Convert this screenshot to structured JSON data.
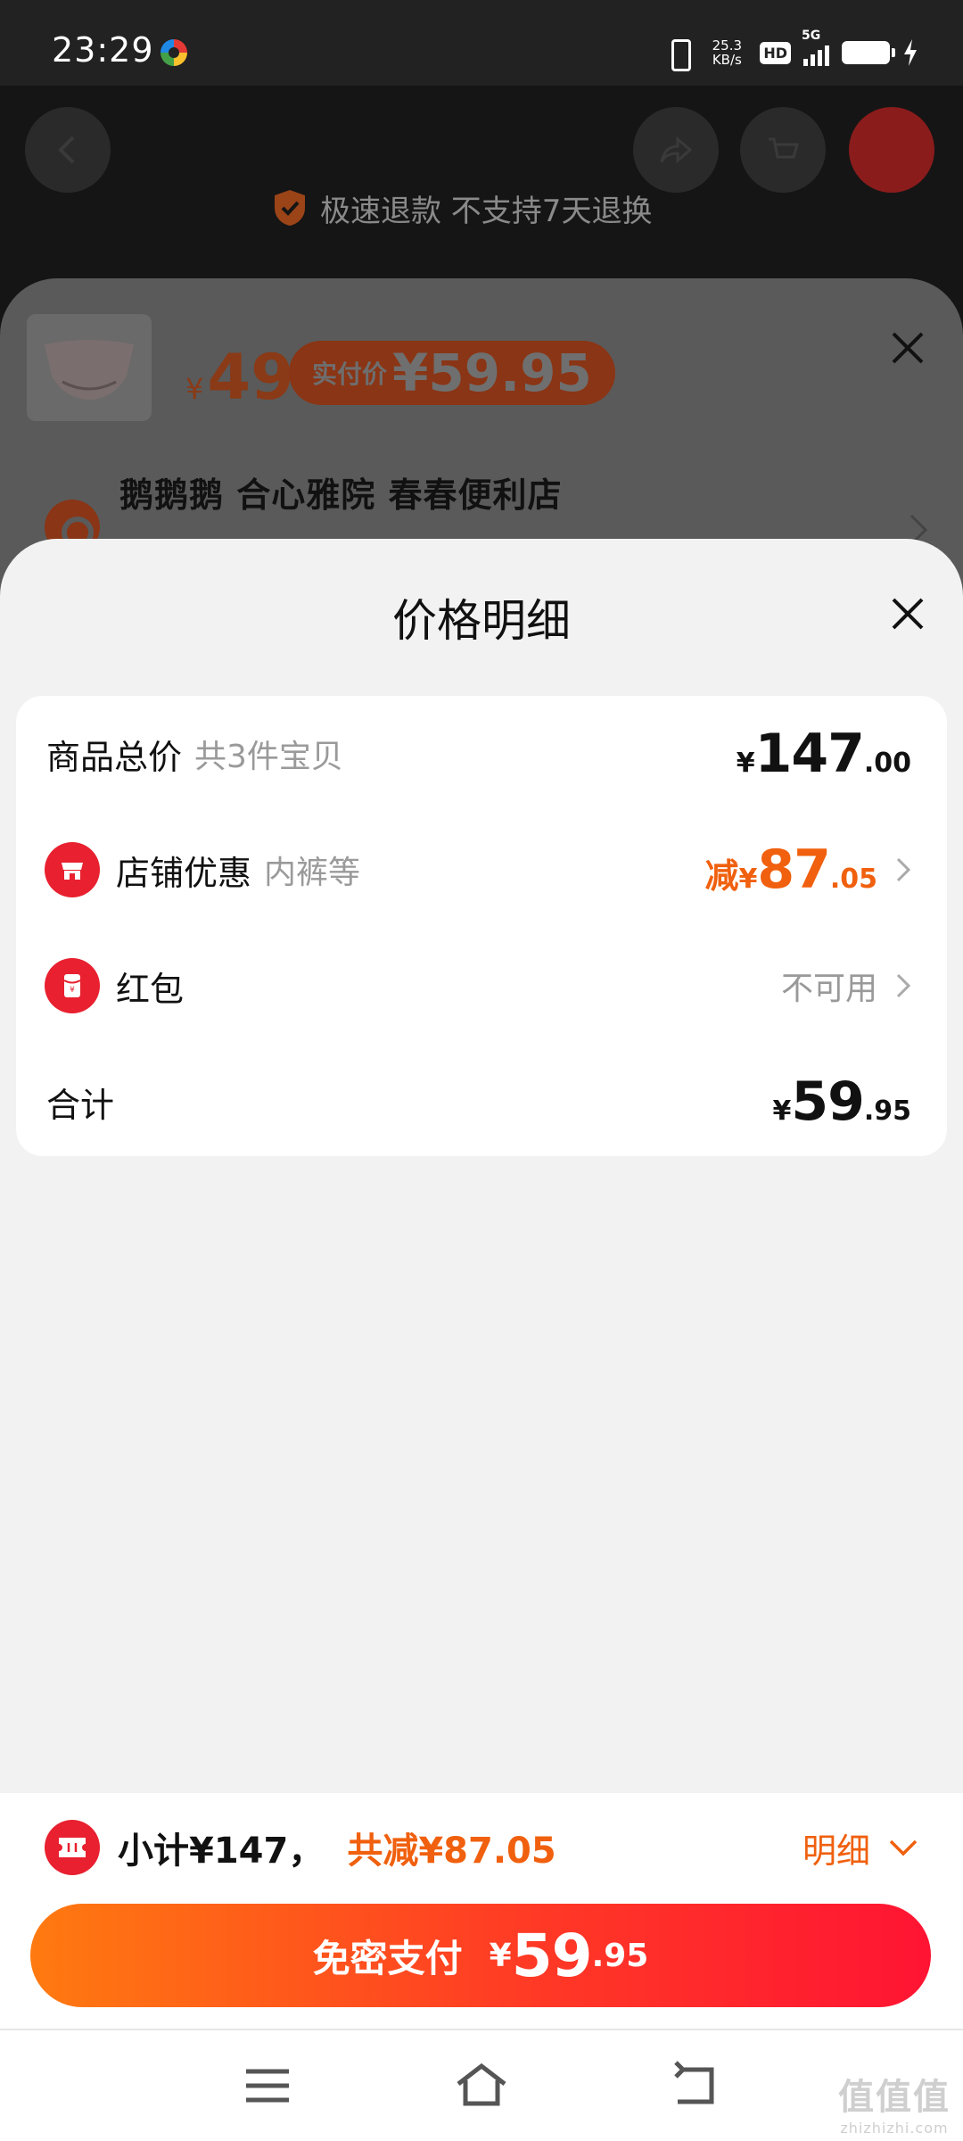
{
  "status_bar": {
    "time": "23:29",
    "net_speed_value": "25.3",
    "net_speed_unit": "KB/s",
    "hd_badge": "HD",
    "network": "5G"
  },
  "product_page": {
    "refund_notice": "极速退款 不支持7天退换"
  },
  "sku_sheet": {
    "currency": "¥",
    "price": "49",
    "paid_label": "实付价",
    "paid_amount": "¥59.95",
    "store_name": "鹅鹅鹅 合心雅院  春春便利店"
  },
  "price_detail": {
    "title": "价格明细",
    "rows": {
      "total": {
        "label": "商品总价",
        "sub": "共3件宝贝",
        "currency": "¥",
        "integer": "147",
        "decimal": ".00"
      },
      "store_discount": {
        "label": "店铺优惠",
        "sub": "内裤等",
        "prefix": "减",
        "currency": "¥",
        "integer": "87",
        "decimal": ".05"
      },
      "red_packet": {
        "label": "红包",
        "status": "不可用"
      },
      "sum": {
        "label": "合计",
        "currency": "¥",
        "integer": "59",
        "decimal": ".95"
      }
    }
  },
  "bottom_bar": {
    "subtotal": "小计¥147，",
    "total_reduction": "共减¥87.05",
    "detail_toggle": "明细",
    "pay_button": {
      "label": "免密支付",
      "currency": "¥",
      "integer": "59",
      "decimal": ".95"
    }
  },
  "watermark": {
    "text": "值值值",
    "sub": "zhizhizhi.com"
  },
  "colors": {
    "accent_orange": "#f0600e",
    "accent_red": "#e8202f",
    "pay_gradient_start": "#ff7a10",
    "pay_gradient_end": "#ff1433"
  }
}
